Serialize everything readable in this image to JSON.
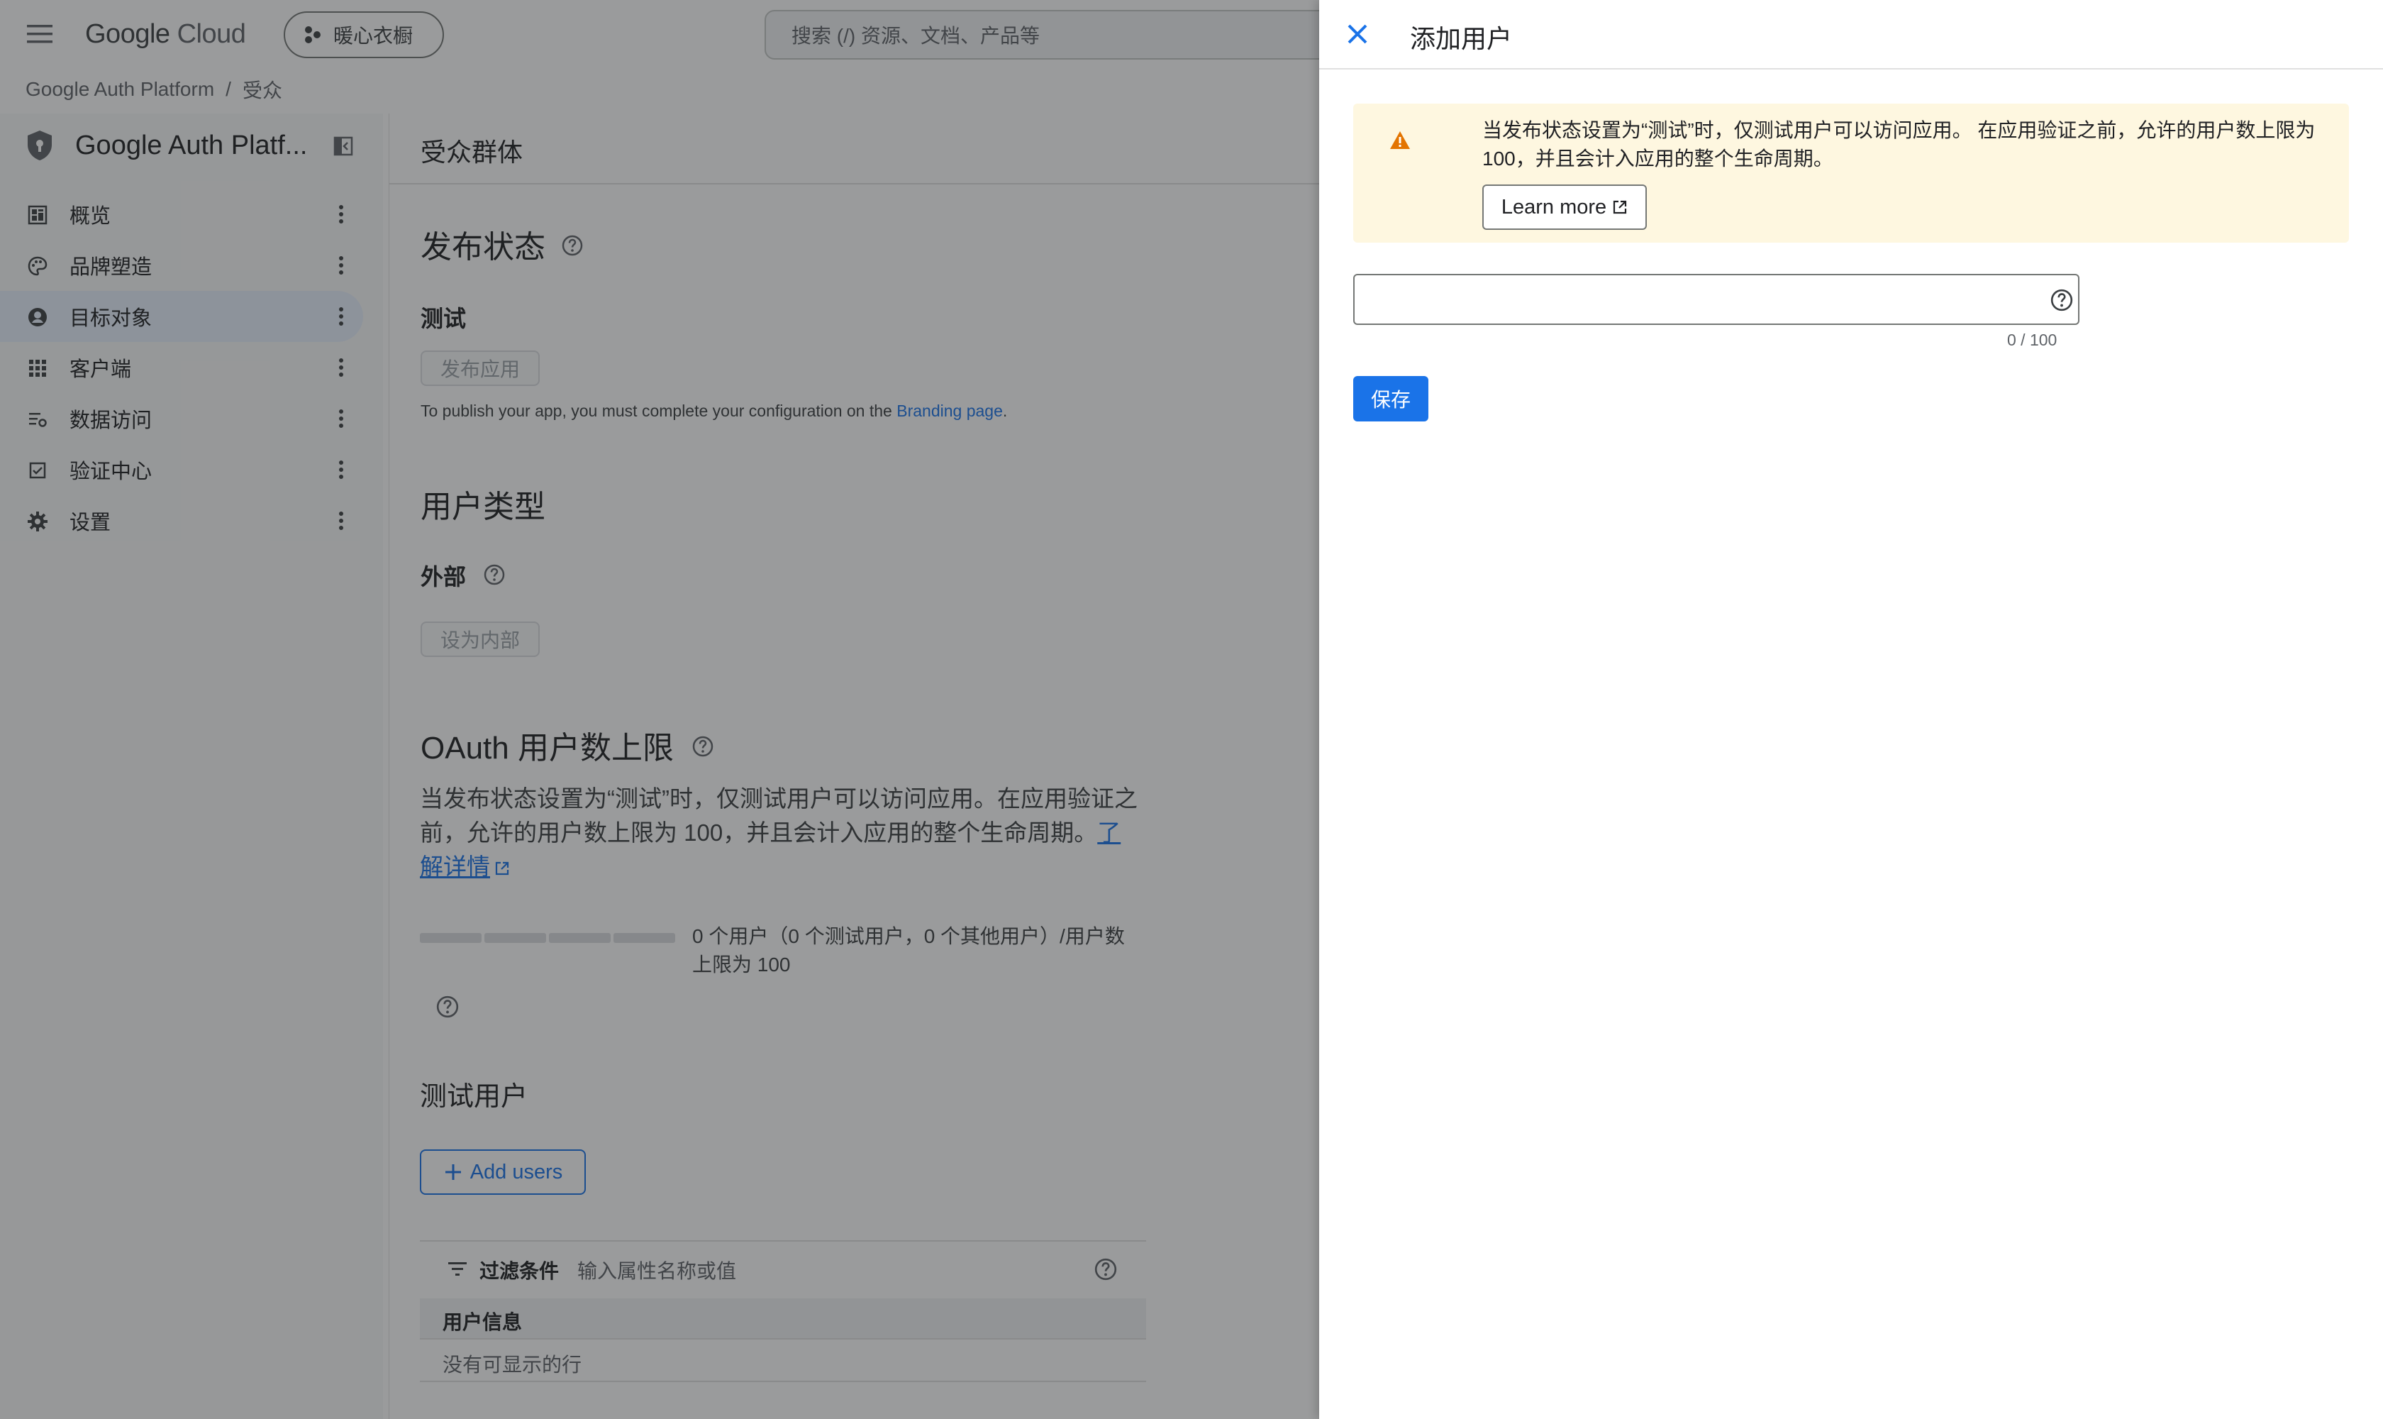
{
  "topbar": {
    "logo_google": "Google",
    "logo_cloud": "Cloud",
    "project": "暖心衣橱",
    "search_placeholder": "搜索 (/) 资源、文档、产品等"
  },
  "breadcrumb": {
    "items": [
      "Google Auth Platform",
      "受众"
    ],
    "separator": "/"
  },
  "sidebar": {
    "product_title": "Google Auth Platf...",
    "items": [
      {
        "label": "概览",
        "icon": "dashboard-icon"
      },
      {
        "label": "品牌塑造",
        "icon": "palette-icon"
      },
      {
        "label": "目标对象",
        "icon": "account-circle-icon",
        "active": true
      },
      {
        "label": "客户端",
        "icon": "apps-grid-icon"
      },
      {
        "label": "数据访问",
        "icon": "data-access-icon"
      },
      {
        "label": "验证中心",
        "icon": "checkbox-icon"
      },
      {
        "label": "设置",
        "icon": "gear-icon"
      }
    ]
  },
  "main": {
    "header_title": "受众群体",
    "publishing": {
      "title": "发布状态",
      "status": "测试",
      "button": "发布应用",
      "note_prefix": "To publish your app, you must complete your configuration on the ",
      "note_link": "Branding page",
      "note_suffix": "."
    },
    "user_type": {
      "title": "用户类型",
      "value": "外部",
      "button": "设为内部"
    },
    "oauth_cap": {
      "title": "OAuth 用户数上限",
      "description": "当发布状态设置为“测试”时，仅测试用户可以访问应用。在应用验证之前，允许的用户数上限为 100，并且会计入应用的整个生命周期。",
      "link": "了解详情",
      "usage_line1": "0 个用户（0 个测试用户，0 个其他用户）/用户数",
      "usage_line2": "上限为 100",
      "usage_fraction": 0
    },
    "test_users": {
      "title": "测试用户",
      "add_button": "Add users",
      "filter_label": "过滤条件",
      "filter_placeholder": "输入属性名称或值",
      "column_header": "用户信息",
      "empty_text": "没有可显示的行"
    }
  },
  "panel": {
    "title": "添加用户",
    "warning_line1": "当发布状态设置为“测试”时，仅测试用户可以访问应用。 在应用验证之前，允许的用户数上限为",
    "warning_line2": "100，并且会计入应用的整个生命周期。",
    "learn_more": "Learn more",
    "input_value": "",
    "char_count": "0 / 100",
    "save_button": "保存"
  },
  "colors": {
    "accent": "#1a73e8",
    "warning_bg": "#fef7e0",
    "warning_icon": "#e37400",
    "active_nav_bg": "#e8f0fe"
  }
}
